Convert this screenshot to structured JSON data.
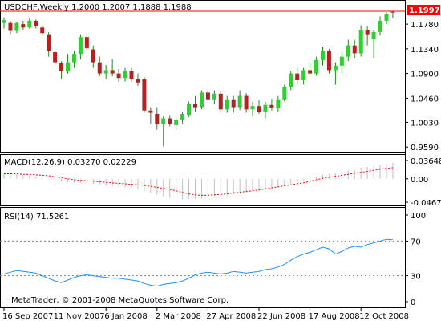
{
  "app": "MetaTrader",
  "symbol_header": "USDCHF,Weekly  1.2000 1.2007 1.1888 1.1988",
  "macd_label": "MACD(12,26,9) 0.03270 0.02229",
  "rsi_label": "RSI(14) 71.5261",
  "copyright": "MetaTrader, © 2001-2008 MetaQuotes Software Corp.",
  "colors": {
    "bull_candle": "#32cd32",
    "bear_candle": "#b22222",
    "wick": "#228b22",
    "price_line": "#ff0000",
    "macd_signal": "#ff0000",
    "macd_hist": "#c0c0c0",
    "rsi_line": "#1e90ff",
    "panel_border": "#000000",
    "grid_dash": "#808080"
  },
  "chart_data": [
    {
      "type": "candlestick",
      "title": "USDCHF,Weekly",
      "ohlc_last": {
        "open": 1.2,
        "high": 1.2007,
        "low": 1.1888,
        "close": 1.1988
      },
      "current_price_label": "1.1997",
      "y_ticks": [
        "1.1780",
        "1.1340",
        "1.0900",
        "1.0460",
        "1.0030",
        "0.9590"
      ],
      "ylim": [
        0.955,
        1.201
      ],
      "x_ticks": [
        "16 Sep 2007",
        "11 Nov 2007",
        "6 Jan 2008",
        "2 Mar 2008",
        "27 Apr 2008",
        "22 Jun 2008",
        "17 Aug 2008",
        "12 Oct 2008"
      ],
      "x_tick_week_index": [
        0,
        8,
        16,
        24,
        32,
        40,
        48,
        56
      ],
      "candles": [
        {
          "o": 1.18,
          "h": 1.19,
          "l": 1.17,
          "c": 1.185
        },
        {
          "o": 1.18,
          "h": 1.184,
          "l": 1.16,
          "c": 1.166
        },
        {
          "o": 1.166,
          "h": 1.182,
          "l": 1.162,
          "c": 1.18
        },
        {
          "o": 1.178,
          "h": 1.184,
          "l": 1.168,
          "c": 1.172
        },
        {
          "o": 1.172,
          "h": 1.188,
          "l": 1.17,
          "c": 1.184
        },
        {
          "o": 1.184,
          "h": 1.186,
          "l": 1.17,
          "c": 1.174
        },
        {
          "o": 1.172,
          "h": 1.176,
          "l": 1.158,
          "c": 1.162
        },
        {
          "o": 1.16,
          "h": 1.164,
          "l": 1.12,
          "c": 1.13
        },
        {
          "o": 1.128,
          "h": 1.132,
          "l": 1.104,
          "c": 1.11
        },
        {
          "o": 1.108,
          "h": 1.112,
          "l": 1.08,
          "c": 1.095
        },
        {
          "o": 1.094,
          "h": 1.125,
          "l": 1.09,
          "c": 1.11
        },
        {
          "o": 1.11,
          "h": 1.13,
          "l": 1.1,
          "c": 1.125
        },
        {
          "o": 1.125,
          "h": 1.16,
          "l": 1.115,
          "c": 1.155
        },
        {
          "o": 1.155,
          "h": 1.158,
          "l": 1.13,
          "c": 1.135
        },
        {
          "o": 1.133,
          "h": 1.14,
          "l": 1.1,
          "c": 1.11
        },
        {
          "o": 1.11,
          "h": 1.12,
          "l": 1.085,
          "c": 1.09
        },
        {
          "o": 1.09,
          "h": 1.105,
          "l": 1.08,
          "c": 1.096
        },
        {
          "o": 1.096,
          "h": 1.115,
          "l": 1.085,
          "c": 1.09
        },
        {
          "o": 1.09,
          "h": 1.098,
          "l": 1.075,
          "c": 1.082
        },
        {
          "o": 1.082,
          "h": 1.1,
          "l": 1.076,
          "c": 1.095
        },
        {
          "o": 1.094,
          "h": 1.1,
          "l": 1.076,
          "c": 1.08
        },
        {
          "o": 1.08,
          "h": 1.09,
          "l": 1.068,
          "c": 1.074
        },
        {
          "o": 1.08,
          "h": 1.084,
          "l": 1.02,
          "c": 1.024
        },
        {
          "o": 1.024,
          "h": 1.03,
          "l": 1.0,
          "c": 1.02
        },
        {
          "o": 1.018,
          "h": 1.03,
          "l": 0.99,
          "c": 1.0
        },
        {
          "o": 1.0,
          "h": 1.014,
          "l": 0.96,
          "c": 1.01
        },
        {
          "o": 1.01,
          "h": 1.016,
          "l": 0.996,
          "c": 1.0
        },
        {
          "o": 0.998,
          "h": 1.012,
          "l": 0.99,
          "c": 1.008
        },
        {
          "o": 1.008,
          "h": 1.022,
          "l": 1.0,
          "c": 1.018
        },
        {
          "o": 1.016,
          "h": 1.04,
          "l": 1.012,
          "c": 1.036
        },
        {
          "o": 1.036,
          "h": 1.05,
          "l": 1.022,
          "c": 1.03
        },
        {
          "o": 1.03,
          "h": 1.06,
          "l": 1.026,
          "c": 1.056
        },
        {
          "o": 1.056,
          "h": 1.062,
          "l": 1.04,
          "c": 1.044
        },
        {
          "o": 1.044,
          "h": 1.06,
          "l": 1.035,
          "c": 1.054
        },
        {
          "o": 1.054,
          "h": 1.058,
          "l": 1.02,
          "c": 1.026
        },
        {
          "o": 1.026,
          "h": 1.05,
          "l": 1.02,
          "c": 1.044
        },
        {
          "o": 1.044,
          "h": 1.05,
          "l": 1.02,
          "c": 1.03
        },
        {
          "o": 1.03,
          "h": 1.06,
          "l": 1.025,
          "c": 1.05
        },
        {
          "o": 1.05,
          "h": 1.055,
          "l": 1.02,
          "c": 1.026
        },
        {
          "o": 1.026,
          "h": 1.04,
          "l": 1.015,
          "c": 1.032
        },
        {
          "o": 1.032,
          "h": 1.042,
          "l": 1.018,
          "c": 1.022
        },
        {
          "o": 1.022,
          "h": 1.04,
          "l": 1.01,
          "c": 1.034
        },
        {
          "o": 1.034,
          "h": 1.045,
          "l": 1.024,
          "c": 1.028
        },
        {
          "o": 1.028,
          "h": 1.05,
          "l": 1.022,
          "c": 1.044
        },
        {
          "o": 1.044,
          "h": 1.07,
          "l": 1.04,
          "c": 1.066
        },
        {
          "o": 1.066,
          "h": 1.095,
          "l": 1.06,
          "c": 1.09
        },
        {
          "o": 1.09,
          "h": 1.1,
          "l": 1.07,
          "c": 1.078
        },
        {
          "o": 1.078,
          "h": 1.1,
          "l": 1.07,
          "c": 1.096
        },
        {
          "o": 1.096,
          "h": 1.11,
          "l": 1.086,
          "c": 1.09
        },
        {
          "o": 1.09,
          "h": 1.12,
          "l": 1.086,
          "c": 1.114
        },
        {
          "o": 1.114,
          "h": 1.138,
          "l": 1.104,
          "c": 1.13
        },
        {
          "o": 1.13,
          "h": 1.134,
          "l": 1.09,
          "c": 1.096
        },
        {
          "o": 1.096,
          "h": 1.11,
          "l": 1.07,
          "c": 1.104
        },
        {
          "o": 1.104,
          "h": 1.13,
          "l": 1.09,
          "c": 1.12
        },
        {
          "o": 1.12,
          "h": 1.15,
          "l": 1.112,
          "c": 1.14
        },
        {
          "o": 1.14,
          "h": 1.15,
          "l": 1.118,
          "c": 1.126
        },
        {
          "o": 1.126,
          "h": 1.176,
          "l": 1.12,
          "c": 1.168
        },
        {
          "o": 1.168,
          "h": 1.174,
          "l": 1.14,
          "c": 1.16
        },
        {
          "o": 1.152,
          "h": 1.168,
          "l": 1.118,
          "c": 1.164
        },
        {
          "o": 1.164,
          "h": 1.192,
          "l": 1.158,
          "c": 1.184
        },
        {
          "o": 1.184,
          "h": 1.199,
          "l": 1.178,
          "c": 1.196
        },
        {
          "o": 1.2,
          "h": 1.2007,
          "l": 1.1888,
          "c": 1.1988
        }
      ]
    },
    {
      "type": "macd",
      "params": "12,26,9",
      "values": {
        "macd": 0.0327,
        "signal": 0.02229
      },
      "y_ticks": [
        "0.03648",
        "0.00",
        "-0.04674"
      ],
      "ylim": [
        -0.04674,
        0.03648
      ],
      "histogram": [
        0.012,
        0.011,
        0.009,
        0.007,
        0.006,
        0.004,
        0.002,
        -0.001,
        -0.004,
        -0.006,
        -0.007,
        -0.008,
        -0.008,
        -0.009,
        -0.01,
        -0.012,
        -0.014,
        -0.015,
        -0.016,
        -0.017,
        -0.018,
        -0.02,
        -0.024,
        -0.028,
        -0.032,
        -0.036,
        -0.038,
        -0.04,
        -0.041,
        -0.041,
        -0.04,
        -0.039,
        -0.037,
        -0.035,
        -0.034,
        -0.033,
        -0.031,
        -0.03,
        -0.028,
        -0.026,
        -0.024,
        -0.022,
        -0.02,
        -0.018,
        -0.014,
        -0.01,
        -0.006,
        -0.003,
        0.0,
        0.004,
        0.008,
        0.01,
        0.011,
        0.014,
        0.016,
        0.018,
        0.022,
        0.024,
        0.026,
        0.028,
        0.03,
        0.0327
      ],
      "signal_line": [
        0.01,
        0.01,
        0.01,
        0.009,
        0.009,
        0.008,
        0.007,
        0.006,
        0.004,
        0.002,
        0.0,
        -0.002,
        -0.003,
        -0.004,
        -0.005,
        -0.006,
        -0.007,
        -0.008,
        -0.009,
        -0.01,
        -0.011,
        -0.012,
        -0.013,
        -0.015,
        -0.017,
        -0.019,
        -0.021,
        -0.024,
        -0.027,
        -0.03,
        -0.032,
        -0.033,
        -0.033,
        -0.032,
        -0.031,
        -0.03,
        -0.028,
        -0.027,
        -0.025,
        -0.024,
        -0.022,
        -0.02,
        -0.018,
        -0.016,
        -0.014,
        -0.012,
        -0.01,
        -0.008,
        -0.005,
        -0.002,
        0.001,
        0.003,
        0.005,
        0.007,
        0.009,
        0.011,
        0.013,
        0.015,
        0.017,
        0.019,
        0.021,
        0.02229
      ]
    },
    {
      "type": "line",
      "name": "RSI",
      "params": "14",
      "current": 71.5261,
      "y_ticks": [
        "100",
        "70",
        "30",
        "0"
      ],
      "levels": [
        70,
        30
      ],
      "ylim": [
        0,
        100
      ],
      "values": [
        32,
        34,
        36,
        35,
        34,
        33,
        30,
        27,
        24,
        22,
        25,
        28,
        30,
        31,
        30,
        29,
        28,
        27,
        27,
        26,
        25,
        24,
        21,
        19,
        18,
        20,
        21,
        22,
        24,
        27,
        31,
        33,
        34,
        33,
        32,
        33,
        35,
        34,
        33,
        34,
        35,
        37,
        38,
        40,
        43,
        48,
        52,
        55,
        57,
        60,
        63,
        61,
        55,
        58,
        62,
        64,
        63,
        66,
        68,
        70,
        72,
        71.5
      ]
    }
  ]
}
